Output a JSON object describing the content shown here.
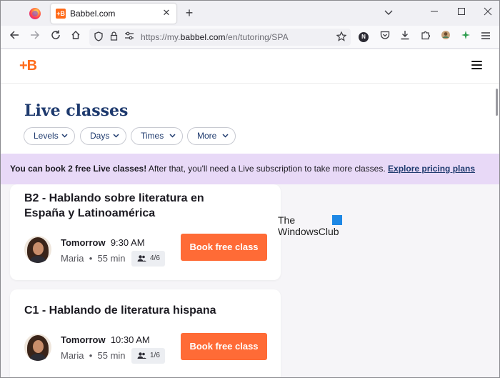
{
  "browser": {
    "tab_title": "Babbel.com",
    "tab_favicon_text": "+B",
    "close_glyph": "✕",
    "newtab_glyph": "+",
    "url_prefix": "https://my.",
    "url_host": "babbel.com",
    "url_path": "/en/tutoring/SPA",
    "extension_badge": "N"
  },
  "site": {
    "brand": "+B",
    "page_title": "Live classes",
    "filters": [
      {
        "label": "Levels"
      },
      {
        "label": "Days"
      },
      {
        "label": "Times"
      },
      {
        "label": "More"
      }
    ],
    "banner": {
      "bold": "You can book 2 free Live classes!",
      "text": " After that, you'll need a Live subscription to take more classes. ",
      "link": "Explore pricing plans"
    },
    "classes": [
      {
        "title": "B2 - Hablando sobre literatura en España y Latinoamérica",
        "day": "Tomorrow",
        "time": "9:30 AM",
        "tutor": "Maria",
        "duration": "55 min",
        "seats": "4/6",
        "button": "Book free class"
      },
      {
        "title": "C1 - Hablando de literatura hispana",
        "day": "Tomorrow",
        "time": "10:30 AM",
        "tutor": "Maria",
        "duration": "55 min",
        "seats": "1/6",
        "button": "Book free class"
      }
    ],
    "watermark_line1": "The",
    "watermark_line2": "WindowsClub"
  },
  "colors": {
    "brand_orange": "#ff6b1a",
    "button_orange": "#ff6b36",
    "title_navy": "#1e3a6e",
    "banner_lilac": "#e8d9f7"
  }
}
